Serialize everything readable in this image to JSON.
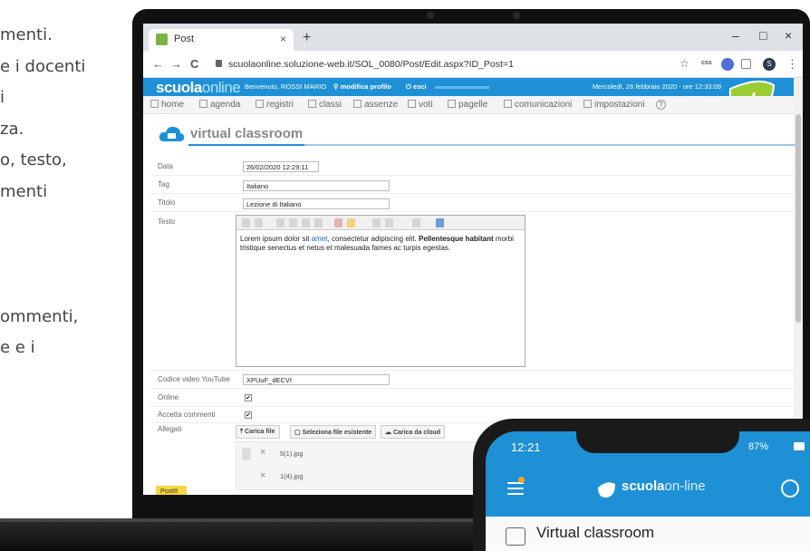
{
  "bg_text": [
    "menti.",
    "e i docenti",
    "i",
    "za.",
    "o, testo,",
    "menti",
    "",
    "",
    "",
    "ommenti,",
    "e e i"
  ],
  "browser": {
    "tab_title": "Post",
    "tab_close": "×",
    "new_tab": "+",
    "url": "scuolaonline.soluzione-web.it/SOL_0080/Post/Edit.aspx?ID_Post=1",
    "nav_back": "←",
    "nav_forward": "→",
    "nav_reload": "C",
    "star": "☆",
    "ext_css": "css",
    "profile": "S",
    "more": "⋮",
    "win_min": "–",
    "win_max": "□",
    "win_close": "×"
  },
  "header": {
    "brand_bold": "scuola",
    "brand_thin": "online",
    "welcome": "Benvenuto, ROSSI MARIO",
    "edit_profile": "modifica profilo",
    "logout": "esci",
    "date": "Mercoledì, 26 febbraio 2020 - ore 12:33:09",
    "logo_text": "ol"
  },
  "menu": [
    "home",
    "agenda",
    "registri",
    "classi",
    "assenze",
    "voti",
    "pagelle",
    "comunicazioni",
    "impostazioni"
  ],
  "menu_help": "?",
  "page": {
    "title": "virtual classroom",
    "fields": {
      "data_label": "Data",
      "data_value": "26/02/2020 12:29:11",
      "tag_label": "Tag",
      "tag_value": "Italiano",
      "titolo_label": "Titolo",
      "titolo_value": "Lezione di Italiano",
      "testo_label": "Testo",
      "youtube_label": "Codice video YouTube",
      "youtube_value": "XPUuF_dECVI",
      "online_label": "Online",
      "accetta_label": "Accetta commenti",
      "allegati_label": "Allegati"
    },
    "editor": {
      "p1": "Lorem ipsum dolor sit ",
      "link": "amet",
      "p2": ", consectetur adipiscing elit. ",
      "bold": "Pellentesque habitant",
      "p3": " morbi tristique senectus et netus et malesuada fames ac turpis egestas.",
      "toolbar": [
        "B",
        "I",
        "≡",
        "≡",
        "≡",
        "≡",
        "T",
        "A",
        "☰",
        "☰",
        "◐",
        "<>"
      ]
    },
    "check_mark": "✔",
    "buttons": {
      "carica_file": "Carica file",
      "seleziona": "Seleziona file esistente",
      "cloud": "Carica da cloud"
    },
    "attachments": [
      "5(1).jpg",
      "1(4).jpg"
    ],
    "remove": "×",
    "postit": "PostIt"
  },
  "phone": {
    "time": "12:21",
    "status": "87%",
    "brand_bold": "scuola",
    "brand_thin": "on-line",
    "section": "Virtual classroom"
  },
  "colors": {
    "accent": "#1e90d6",
    "postit": "#f5d742",
    "logo_green": "#9acd32"
  }
}
